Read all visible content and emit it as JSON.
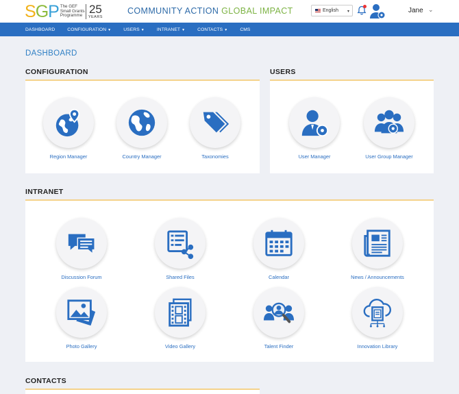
{
  "header": {
    "logo": {
      "letters": [
        "S",
        "G",
        "P"
      ],
      "small_text": "The GEF Small Grants Programme",
      "years_number": "25",
      "years_word": "YEARS"
    },
    "tagline_part1": "COMMUNITY ACTION",
    "tagline_part2": "GLOBAL IMPACT",
    "language": "English",
    "user_name": "Jane"
  },
  "nav": {
    "items": [
      {
        "label": "DASHBOARD",
        "has_menu": false
      },
      {
        "label": "CONFIGURATION",
        "has_menu": true
      },
      {
        "label": "USERS",
        "has_menu": true
      },
      {
        "label": "INTRANET",
        "has_menu": true
      },
      {
        "label": "CONTACTS",
        "has_menu": true
      },
      {
        "label": "CMS",
        "has_menu": false
      }
    ]
  },
  "page_title": "DASHBOARD",
  "sections": {
    "configuration": {
      "title": "CONFIGURATION",
      "tiles": [
        {
          "label": "Region Manager",
          "icon": "globe-pin-icon"
        },
        {
          "label": "Country Manager",
          "icon": "globe-icon"
        },
        {
          "label": "Taxonomies",
          "icon": "tags-icon"
        }
      ]
    },
    "users": {
      "title": "USERS",
      "tiles": [
        {
          "label": "User Manager",
          "icon": "user-gear-icon"
        },
        {
          "label": "User Group Manager",
          "icon": "users-gear-icon"
        }
      ]
    },
    "intranet": {
      "title": "INTRANET",
      "tiles": [
        {
          "label": "Discussion Forum",
          "icon": "chat-bubbles-icon"
        },
        {
          "label": "Shared Files",
          "icon": "share-list-icon"
        },
        {
          "label": "Calendar",
          "icon": "calendar-icon"
        },
        {
          "label": "News / Announcements",
          "icon": "newspaper-icon"
        },
        {
          "label": "Photo Gallery",
          "icon": "photo-icon"
        },
        {
          "label": "Video Gallery",
          "icon": "film-icon"
        },
        {
          "label": "Talent Finder",
          "icon": "people-search-icon"
        },
        {
          "label": "Innovation Library",
          "icon": "cloud-book-icon"
        }
      ]
    },
    "contacts": {
      "title": "CONTACTS"
    }
  },
  "colors": {
    "nav_blue": "#2a6ec1",
    "icon_blue": "#2a6ec1",
    "panel_accent": "#f4d28a",
    "page_bg": "#eef0f5"
  }
}
